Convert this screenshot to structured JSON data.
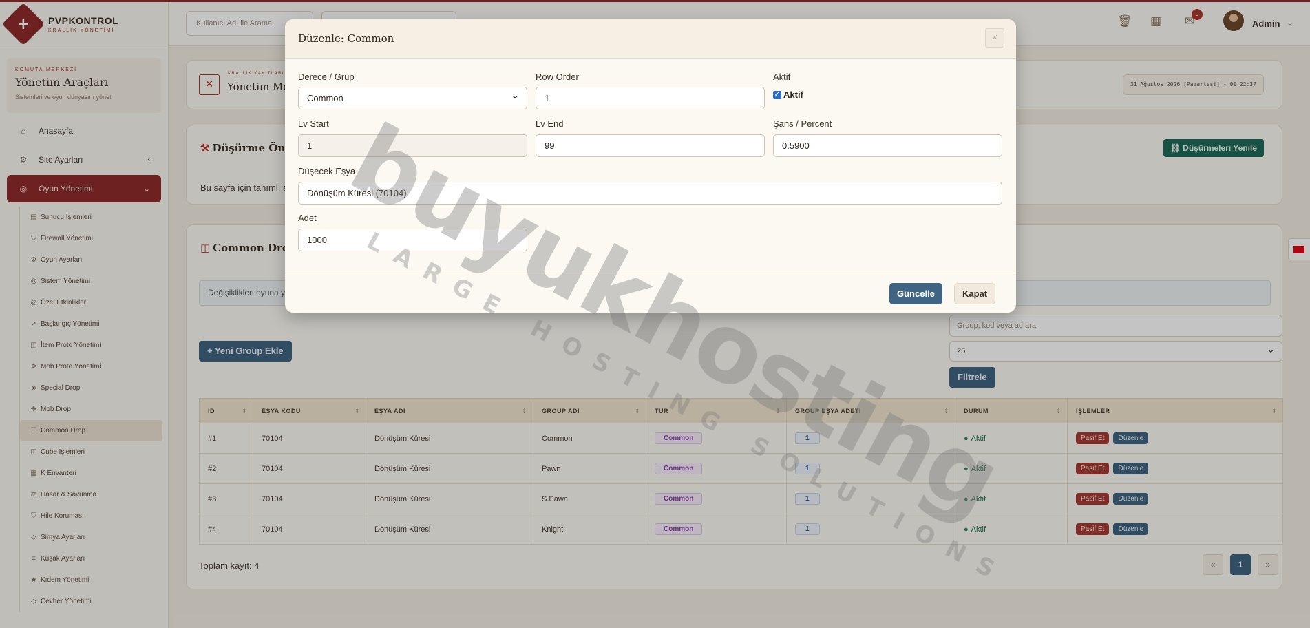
{
  "brand": {
    "title": "PVPKONTROL",
    "subtitle": "KRALLIK YÖNETİMİ"
  },
  "sidebar": {
    "kicker": "KOMUTA MERKEZİ",
    "title": "Yönetim Araçları",
    "desc": "Sistemleri ve oyun dünyasını yönet",
    "items": [
      {
        "label": "Anasayfa",
        "icon": "home-icon"
      },
      {
        "label": "Site Ayarları",
        "icon": "gear-icon"
      },
      {
        "label": "Oyun Yönetimi",
        "icon": "gamepad-icon"
      }
    ],
    "sub_items": [
      {
        "label": "Sunucu İşlemleri"
      },
      {
        "label": "Firewall Yönetimi"
      },
      {
        "label": "Oyun Ayarları"
      },
      {
        "label": "Sistem Yönetimi"
      },
      {
        "label": "Özel Etkinlikler"
      },
      {
        "label": "Başlangıç Yönetimi"
      },
      {
        "label": "İtem Proto Yönetimi"
      },
      {
        "label": "Mob Proto Yönetimi"
      },
      {
        "label": "Special Drop"
      },
      {
        "label": "Mob Drop"
      },
      {
        "label": "Common Drop"
      },
      {
        "label": "Cube İşlemleri"
      },
      {
        "label": "K Envanteri"
      },
      {
        "label": "Hasar & Savunma"
      },
      {
        "label": "Hile Koruması"
      },
      {
        "label": "Simya Ayarları"
      },
      {
        "label": "Kuşak Ayarları"
      },
      {
        "label": "Kıdem Yönetimi"
      },
      {
        "label": "Cevher Yönetimi"
      }
    ]
  },
  "topbar": {
    "search_placeholder": "Kullanıcı Adı ile Arama",
    "notif_count": "0",
    "user": "Admin"
  },
  "header": {
    "kicker": "KRALLIK KAYITLARI",
    "title": "Yönetim Merkezi",
    "date": "31 Ağustos 2026 [Pazartesi] - 00:22:37"
  },
  "cache": {
    "title": "Düşürme Önbelleği",
    "button": "Düşürmeleri Yenile",
    "message": "Bu sayfa için tanımlı süre yok."
  },
  "list": {
    "title": "Common Drop",
    "alert": "Değişiklikleri oyuna yansıtmak için düşürmeleri yenileyin.",
    "search_placeholder": "Group, kod veya ad ara",
    "page_size": "25",
    "filter_button": "Filtrele",
    "add_button": "Yeni Group Ekle",
    "columns": [
      "ID",
      "EŞYA KODU",
      "EŞYA ADI",
      "GROUP ADI",
      "TÜR",
      "GROUP EŞYA ADETİ",
      "DURUM",
      "İŞLEMLER"
    ],
    "rows": [
      {
        "id": "#1",
        "code": "70104",
        "name": "Dönüşüm Küresi",
        "group": "Common",
        "type": "Common",
        "count": "1",
        "status": "Aktif",
        "btn_passive": "Pasif Et",
        "btn_edit": "Düzenle"
      },
      {
        "id": "#2",
        "code": "70104",
        "name": "Dönüşüm Küresi",
        "group": "Pawn",
        "type": "Common",
        "count": "1",
        "status": "Aktif",
        "btn_passive": "Pasif Et",
        "btn_edit": "Düzenle"
      },
      {
        "id": "#3",
        "code": "70104",
        "name": "Dönüşüm Küresi",
        "group": "S.Pawn",
        "type": "Common",
        "count": "1",
        "status": "Aktif",
        "btn_passive": "Pasif Et",
        "btn_edit": "Düzenle"
      },
      {
        "id": "#4",
        "code": "70104",
        "name": "Dönüşüm Küresi",
        "group": "Knight",
        "type": "Common",
        "count": "1",
        "status": "Aktif",
        "btn_passive": "Pasif Et",
        "btn_edit": "Düzenle"
      }
    ],
    "total": "Toplam kayıt: 4",
    "pager": {
      "prev": "«",
      "current": "1",
      "next": "»"
    }
  },
  "modal": {
    "title": "Düzenle: Common",
    "fields": {
      "group_label": "Derece / Grup",
      "group_value": "Common",
      "row_order_label": "Row Order",
      "row_order_value": "1",
      "active_label": "Aktif",
      "active_check": "Aktif",
      "lv_start_label": "Lv Start",
      "lv_start_value": "1",
      "lv_end_label": "Lv End",
      "lv_end_value": "99",
      "chance_label": "Şans / Percent",
      "chance_value": "0.5900",
      "item_label": "Düşecek Eşya",
      "item_value": "Dönüşüm Küresi (70104)",
      "count_label": "Adet",
      "count_value": "1000"
    },
    "update_button": "Güncelle",
    "close_button": "Kapat",
    "close_icon": "×"
  },
  "watermark": {
    "main": "buyukhosting",
    "sub": "LARGE HOSTING SOLUTIONS"
  },
  "colors": {
    "brand": "#8e2b2b",
    "primary": "#3f6583",
    "success": "#1f6b5a",
    "danger": "#a83a32"
  }
}
